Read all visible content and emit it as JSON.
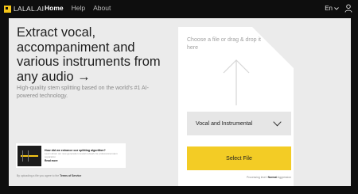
{
  "nav": {
    "logo": "LALAL.AI",
    "links": [
      "Home",
      "Help",
      "About"
    ],
    "language": "En"
  },
  "hero": {
    "title": "Extract vocal, accompaniment and various instruments from any audio →",
    "subtitle": "High-quality stem splitting based on the world's #1 AI-powered technology."
  },
  "promo": {
    "title": "How did we enhance our splitting algorithm?",
    "body": "Learn about our new generation neural network for professional stem separation",
    "link": "Read more"
  },
  "terms": {
    "prefix": "By uploading a file you agree to the",
    "link": "Terms of Service"
  },
  "upload": {
    "hint": "Choose a file or drag & drop it here",
    "stem_option": "Vocal and Instrumental",
    "button_label": "Select File",
    "footnote_prefix": "Processing level:",
    "footnote_level": "Normal",
    "footnote_suffix": "Aggression"
  },
  "colors": {
    "accent": "#f3cc25",
    "background": "#0e0e0e",
    "card": "#ebebeb"
  },
  "icons": {
    "logo": "logo-mark-icon",
    "language": "chevron-down-icon",
    "account": "user-icon",
    "upload": "arrow-up-icon",
    "select": "chevron-down-icon"
  }
}
